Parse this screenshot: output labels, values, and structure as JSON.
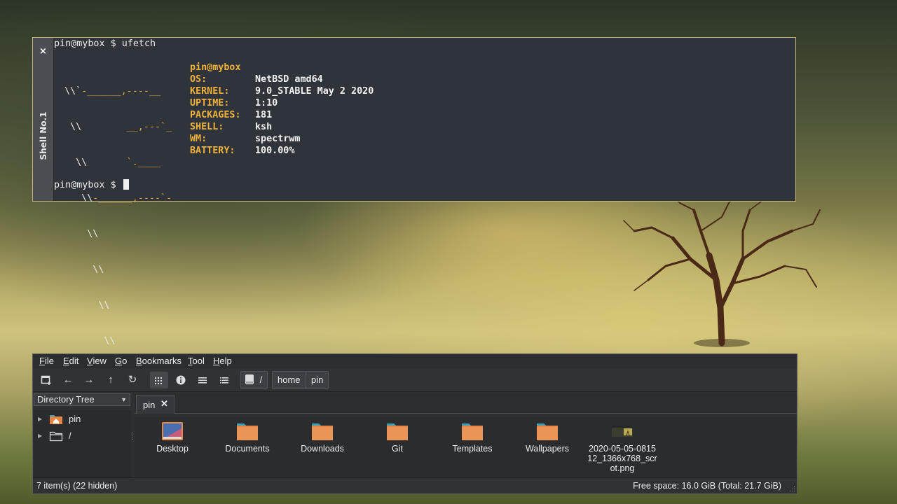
{
  "terminal": {
    "tab_title": "Shell No.1",
    "close_glyph": "×",
    "command_line": "pin@mybox $ ufetch",
    "prompt": "pin@mybox $ ",
    "userhost": "pin@mybox",
    "ascii_lines": [
      [
        "\\\\`",
        "-______,----__"
      ],
      [
        " \\\\",
        "        __,---`_"
      ],
      [
        "  \\\\",
        "       `.____"
      ],
      [
        "   \\\\",
        "-______,----`-"
      ],
      [
        "    \\\\",
        ""
      ],
      [
        "     \\\\",
        ""
      ],
      [
        "      \\\\",
        ""
      ],
      [
        "       \\\\",
        ""
      ]
    ],
    "info": [
      {
        "key": "OS:",
        "value": "NetBSD amd64"
      },
      {
        "key": "KERNEL:",
        "value": "9.0_STABLE May 2 2020"
      },
      {
        "key": "UPTIME:",
        "value": "1:10"
      },
      {
        "key": "PACKAGES:",
        "value": "181"
      },
      {
        "key": "SHELL:",
        "value": "ksh"
      },
      {
        "key": "WM:",
        "value": "spectrwm"
      },
      {
        "key": "BATTERY:",
        "value": "100.00%"
      }
    ]
  },
  "file_manager": {
    "menu": [
      {
        "label": "File",
        "accel": "F",
        "rest": "ile"
      },
      {
        "label": "Edit",
        "accel": "E",
        "rest": "dit"
      },
      {
        "label": "View",
        "accel": "V",
        "rest": "iew"
      },
      {
        "label": "Go",
        "accel": "G",
        "rest": "o"
      },
      {
        "label": "Bookmarks",
        "accel": "B",
        "rest": "ookmarks"
      },
      {
        "label": "Tool",
        "accel": "T",
        "rest": "ool"
      },
      {
        "label": "Help",
        "accel": "H",
        "rest": "elp"
      }
    ],
    "path": [
      "/",
      "home",
      "pin"
    ],
    "side_panel_mode": "Directory Tree",
    "tree": [
      "pin",
      "/"
    ],
    "tab": {
      "label": "pin",
      "close": "✕"
    },
    "files": [
      {
        "name": "Desktop",
        "icon": "desktop-folder-icon"
      },
      {
        "name": "Documents",
        "icon": "folder-icon"
      },
      {
        "name": "Downloads",
        "icon": "folder-icon"
      },
      {
        "name": "Git",
        "icon": "folder-icon"
      },
      {
        "name": "Templates",
        "icon": "folder-icon"
      },
      {
        "name": "Wallpapers",
        "icon": "folder-icon"
      },
      {
        "name": "2020-05-05-081512_1366x768_scrot.png",
        "icon": "image-thumbnail-icon"
      }
    ],
    "status_left": "7 item(s) (22 hidden)",
    "status_right": "Free space: 16.0 GiB (Total: 21.7 GiB)"
  },
  "colors": {
    "accent_orange": "#f0b03c",
    "folder_orange": "#e5874a",
    "folder_tab_teal": "#3f9fb0"
  }
}
